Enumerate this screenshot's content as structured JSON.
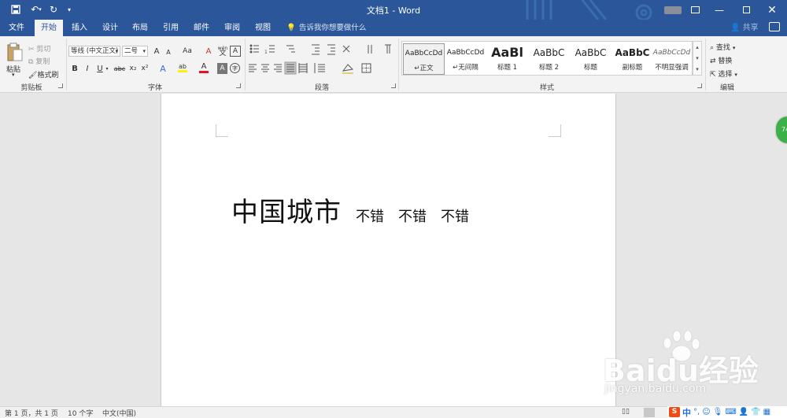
{
  "window": {
    "title": "文档1 - Word",
    "quick_access": {
      "save_icon": "save-icon",
      "undo_icon": "undo-icon",
      "redo_icon": "redo-icon"
    },
    "controls": {
      "restore_ribbon": "ribbon-display-icon",
      "minimize": "minimize-icon",
      "maximize": "maximize-icon",
      "close": "close-icon"
    }
  },
  "tabs": [
    {
      "label": "文件"
    },
    {
      "label": "开始",
      "active": true
    },
    {
      "label": "插入"
    },
    {
      "label": "设计"
    },
    {
      "label": "布局"
    },
    {
      "label": "引用"
    },
    {
      "label": "邮件"
    },
    {
      "label": "审阅"
    },
    {
      "label": "视图"
    }
  ],
  "tell_me": "告诉我你想要做什么",
  "share": "共享",
  "ribbon": {
    "clipboard": {
      "paste": "粘贴",
      "cut": "剪切",
      "copy": "复制",
      "format_painter": "格式刷",
      "group": "剪贴板"
    },
    "font": {
      "font_name": "等线 (中文正文)",
      "font_size": "二号",
      "buttons": {
        "bold": "B",
        "italic": "I",
        "underline": "U",
        "strikethrough": "abc",
        "subscript": "x₂",
        "superscript": "x²",
        "grow": "A",
        "shrink": "A",
        "change_case": "Aa",
        "clear_format": "A",
        "phonetic": "wén",
        "char_border": "A",
        "text_effect": "A",
        "highlight": "ab",
        "font_color": "A",
        "char_shading": "A",
        "enclose": "字"
      },
      "group": "字体"
    },
    "paragraph": {
      "group": "段落"
    },
    "styles": {
      "group": "样式",
      "items": [
        {
          "sample": "AaBbCcDd",
          "name": "正文",
          "selected": true
        },
        {
          "sample": "AaBbCcDd",
          "name": "无间隔"
        },
        {
          "sample": "AaBl",
          "name": "标题 1"
        },
        {
          "sample": "AaBbC",
          "name": "标题 2"
        },
        {
          "sample": "AaBbC",
          "name": "标题"
        },
        {
          "sample": "AaBbC",
          "name": "副标题"
        },
        {
          "sample": "AaBbCcDd",
          "name": "不明显强调"
        }
      ]
    },
    "editing": {
      "find": "查找",
      "replace": "替换",
      "select": "选择",
      "group": "编辑"
    }
  },
  "document": {
    "heading": "中国城市",
    "words": [
      "不错",
      "不错",
      "不错"
    ]
  },
  "side_badge": "74",
  "status_bar": {
    "page": "第 1 页，共 1 页",
    "words": "10 个字",
    "language": "中文(中国)"
  },
  "tray": {
    "ime": "中",
    "icons": [
      "ime-punctuation-icon",
      "emoji-icon",
      "mic-icon",
      "keyboard-icon",
      "user-icon",
      "shirt-icon",
      "grid-icon"
    ]
  },
  "watermark": {
    "logo": "Baidu经验",
    "url": "jingyan.baidu.com"
  },
  "colors": {
    "accent": "#2b579a",
    "ribbon_bg": "#f3f3f3",
    "canvas": "#e6e6e6",
    "font_color_bar": "#e81123",
    "highlight_bar": "#fff200",
    "badge": "#3cb14a",
    "sogou": "#f04a17"
  }
}
